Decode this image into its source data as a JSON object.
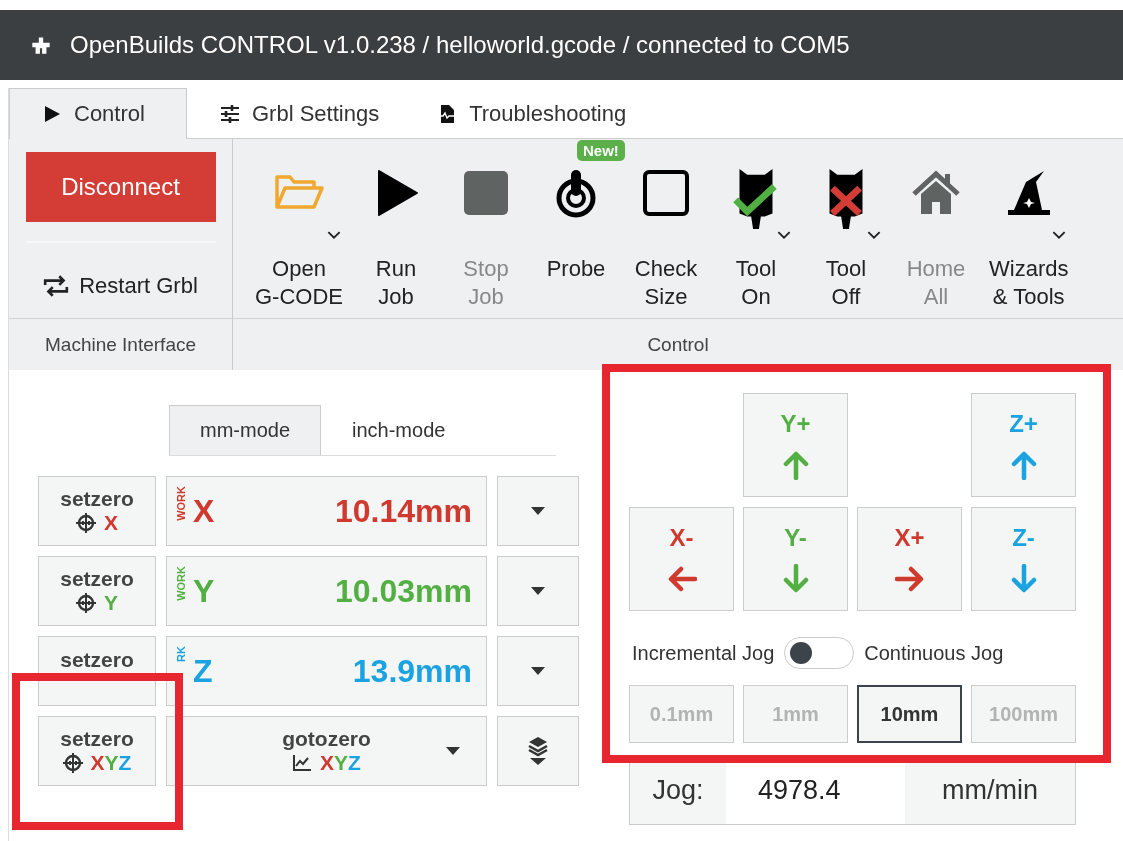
{
  "window": {
    "title": "OpenBuilds CONTROL v1.0.238 / helloworld.gcode / connected to COM5"
  },
  "tabs": [
    {
      "label": "Control",
      "kind": "play",
      "selected": true
    },
    {
      "label": "Grbl Settings",
      "kind": "sliders",
      "selected": false
    },
    {
      "label": "Troubleshooting",
      "kind": "file",
      "selected": false
    }
  ],
  "ribbon": {
    "disconnect": "Disconnect",
    "restart": "Restart Grbl",
    "groups": [
      "Machine Interface",
      "Control"
    ],
    "tools": [
      {
        "lines": [
          "Open",
          "G-CODE"
        ],
        "kind": "folder",
        "dropdown": true,
        "disabled": false
      },
      {
        "lines": [
          "Run",
          "Job"
        ],
        "kind": "play",
        "dropdown": false,
        "disabled": false
      },
      {
        "lines": [
          "Stop",
          "Job"
        ],
        "kind": "stop",
        "dropdown": false,
        "disabled": true
      },
      {
        "lines": [
          "Probe"
        ],
        "kind": "probe",
        "dropdown": false,
        "disabled": false,
        "badge": "New!"
      },
      {
        "lines": [
          "Check",
          "Size"
        ],
        "kind": "square",
        "dropdown": false,
        "disabled": false
      },
      {
        "lines": [
          "Tool",
          "On"
        ],
        "kind": "tool-on",
        "dropdown": true,
        "disabled": false
      },
      {
        "lines": [
          "Tool",
          "Off"
        ],
        "kind": "tool-off",
        "dropdown": true,
        "disabled": false
      },
      {
        "lines": [
          "Home",
          "All"
        ],
        "kind": "home",
        "dropdown": false,
        "disabled": true
      },
      {
        "lines": [
          "Wizards",
          "& Tools"
        ],
        "kind": "wizard",
        "dropdown": true,
        "disabled": false
      }
    ]
  },
  "mode_tabs": [
    {
      "label": "mm-mode",
      "selected": true
    },
    {
      "label": "inch-mode",
      "selected": false
    }
  ],
  "axes": [
    {
      "setzero": "setzero",
      "zero_axis": "X",
      "work": "WORK",
      "axis": "X",
      "value": "10.14mm",
      "color": "#d0392e"
    },
    {
      "setzero": "setzero",
      "zero_axis": "Y",
      "work": "WORK",
      "axis": "Y",
      "value": "10.03mm",
      "color": "#52b043"
    },
    {
      "setzero": "setzero",
      "work": "RK",
      "axis": "Z",
      "value": "13.9mm",
      "color": "#1aa3e0"
    }
  ],
  "setzero_all": {
    "label": "setzero",
    "letters": [
      {
        "text": "X",
        "color": "#d0392e"
      },
      {
        "text": "Y",
        "color": "#52b043"
      },
      {
        "text": "Z",
        "color": "#1aa3e0"
      }
    ]
  },
  "gotozero_all": {
    "label": "gotozero",
    "letters": [
      {
        "text": "X",
        "color": "#d0392e"
      },
      {
        "text": "Y",
        "color": "#52b043"
      },
      {
        "text": "Z",
        "color": "#1aa3e0"
      }
    ]
  },
  "jog_buttons": [
    {
      "label": "Y+",
      "kind": "up",
      "color": "#52b043"
    },
    {
      "label": "Z+",
      "kind": "up",
      "color": "#1aa3e0"
    },
    {
      "label": "X-",
      "kind": "left",
      "color": "#d0392e"
    },
    {
      "label": "Y-",
      "kind": "down",
      "color": "#52b043"
    },
    {
      "label": "X+",
      "kind": "right",
      "color": "#d0392e"
    },
    {
      "label": "Z-",
      "kind": "down",
      "color": "#1aa3e0"
    }
  ],
  "jog_mode": {
    "left": "Incremental Jog",
    "right": "Continuous Jog",
    "on": false
  },
  "steps": [
    {
      "label": "0.1mm",
      "selected": false
    },
    {
      "label": "1mm",
      "selected": false
    },
    {
      "label": "10mm",
      "selected": true
    },
    {
      "label": "100mm",
      "selected": false
    }
  ],
  "feed": {
    "label": "Jog:",
    "value": "4978.4",
    "unit": "mm/min"
  }
}
